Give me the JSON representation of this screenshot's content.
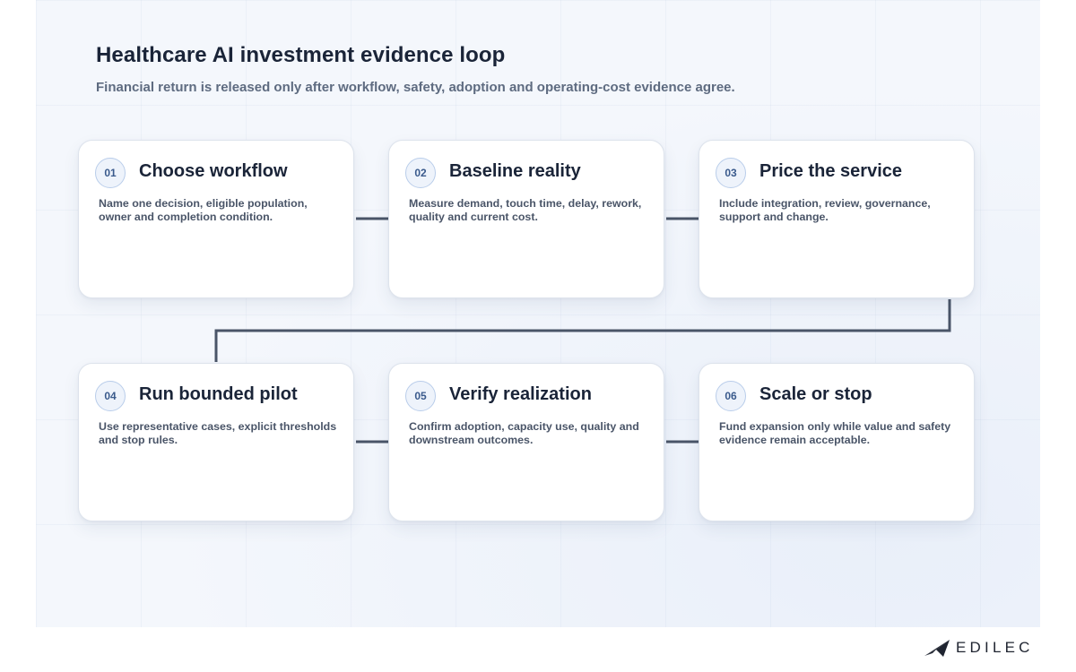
{
  "title": "Healthcare AI investment evidence loop",
  "subtitle": "Financial return is released only after workflow, safety, adoption and operating-cost evidence agree.",
  "steps": [
    {
      "number": "01",
      "title": "Choose workflow",
      "description": "Name one decision, eligible population, owner and completion condition."
    },
    {
      "number": "02",
      "title": "Baseline reality",
      "description": "Measure demand, touch time, delay, rework, quality and current cost."
    },
    {
      "number": "03",
      "title": "Price the service",
      "description": "Include integration, review, governance, support and change."
    },
    {
      "number": "04",
      "title": "Run bounded pilot",
      "description": "Use representative cases, explicit thresholds and stop rules."
    },
    {
      "number": "05",
      "title": "Verify realization",
      "description": "Confirm adoption, capacity use, quality and downstream outcomes."
    },
    {
      "number": "06",
      "title": "Scale or stop",
      "description": "Fund expansion only while value and safety evidence remain acceptable."
    }
  ],
  "brand": {
    "name": "EDILEC",
    "logo_icon": "edilec-logo-icon"
  },
  "colors": {
    "connector": "#4a5568",
    "badge_border": "#b9cdea",
    "badge_text": "#3a5a8c",
    "title": "#1a2438"
  }
}
